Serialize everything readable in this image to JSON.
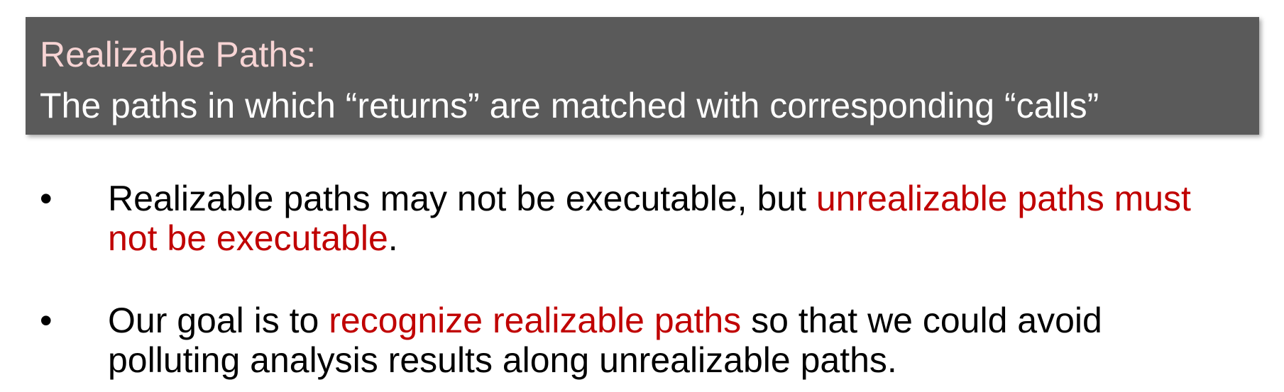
{
  "definition": {
    "title": "Realizable Paths:",
    "text": "The paths in which “returns” are matched with corresponding “calls”"
  },
  "bullets": [
    {
      "marker": "•",
      "before": "Realizable paths may not be executable, but ",
      "highlight": "unrealizable paths must not be executable",
      "after": "."
    },
    {
      "marker": "•",
      "before": "Our goal is to ",
      "highlight": "recognize realizable paths",
      "after": " so that we could avoid polluting analysis results along unrealizable paths."
    }
  ],
  "colors": {
    "box_background": "#5a5a5a",
    "title_color": "#f7d4d4",
    "highlight_color": "#c00000"
  }
}
